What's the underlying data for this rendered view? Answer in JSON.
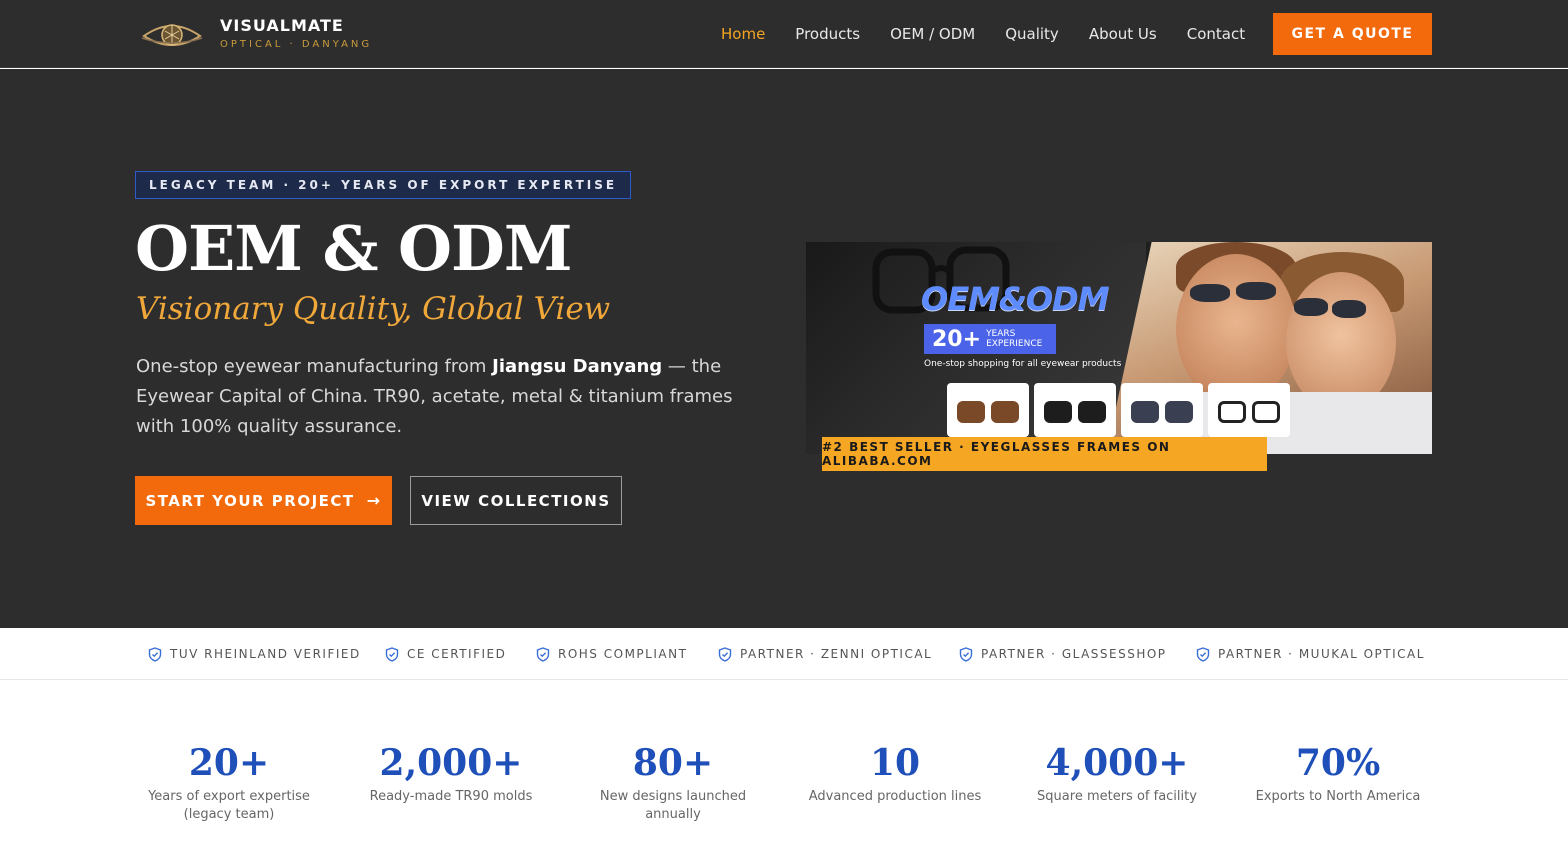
{
  "brand": {
    "name": "VISUALMATE",
    "sub": "OPTICAL · DANYANG"
  },
  "nav": {
    "items": [
      "Home",
      "Products",
      "OEM / ODM",
      "Quality",
      "About Us",
      "Contact"
    ],
    "active": "Home",
    "quote_button": "GET A QUOTE"
  },
  "hero": {
    "badge": "LEGACY TEAM · 20+ YEARS OF EXPORT EXPERTISE",
    "title": "OEM & ODM",
    "tagline": "Visionary Quality, Global View",
    "desc_before": "One-stop eyewear manufacturing from ",
    "desc_bold": "Jiangsu Danyang",
    "desc_after": " — the Eyewear Capital of China. TR90, acetate, metal & titanium frames with 100% quality assurance.",
    "primary_button": "START YOUR PROJECT",
    "primary_icon": "arrow-right-icon",
    "secondary_button": "VIEW COLLECTIONS"
  },
  "banner": {
    "logo": "OEM&ODM",
    "years_num": "20+",
    "years_line1": "YEARS",
    "years_line2": "EXPERIENCE",
    "subtitle": "One-stop shopping for all eyewear products",
    "seller_tag": "#2 BEST SELLER · EYEGLASSES FRAMES ON ALIBABA.COM"
  },
  "certs": [
    {
      "label": "TUV RHEINLAND VERIFIED",
      "icon": "shield-check-icon"
    },
    {
      "label": "CE CERTIFIED",
      "icon": "shield-check-icon"
    },
    {
      "label": "ROHS COMPLIANT",
      "icon": "shield-check-icon"
    },
    {
      "label": "PARTNER · ZENNI OPTICAL",
      "icon": "shield-check-icon"
    },
    {
      "label": "PARTNER · GLASSESSHOP",
      "icon": "shield-check-icon"
    },
    {
      "label": "PARTNER · MUUKAL OPTICAL",
      "icon": "shield-check-icon"
    }
  ],
  "stats": [
    {
      "value": "20+",
      "line1": "Years of export expertise",
      "line2": "(legacy team)"
    },
    {
      "value": "2,000+",
      "line1": "Ready-made TR90 molds",
      "line2": ""
    },
    {
      "value": "80+",
      "line1": "New designs launched",
      "line2": "annually"
    },
    {
      "value": "10",
      "line1": "Advanced production lines",
      "line2": ""
    },
    {
      "value": "4,000+",
      "line1": "Square meters of facility",
      "line2": ""
    },
    {
      "value": "70%",
      "line1": "Exports to North America",
      "line2": ""
    }
  ],
  "colors": {
    "accent": "#f26a0c",
    "gold": "#f0a83a",
    "stat_blue": "#1f4fb8",
    "dark_bg": "#2d2d2d"
  }
}
